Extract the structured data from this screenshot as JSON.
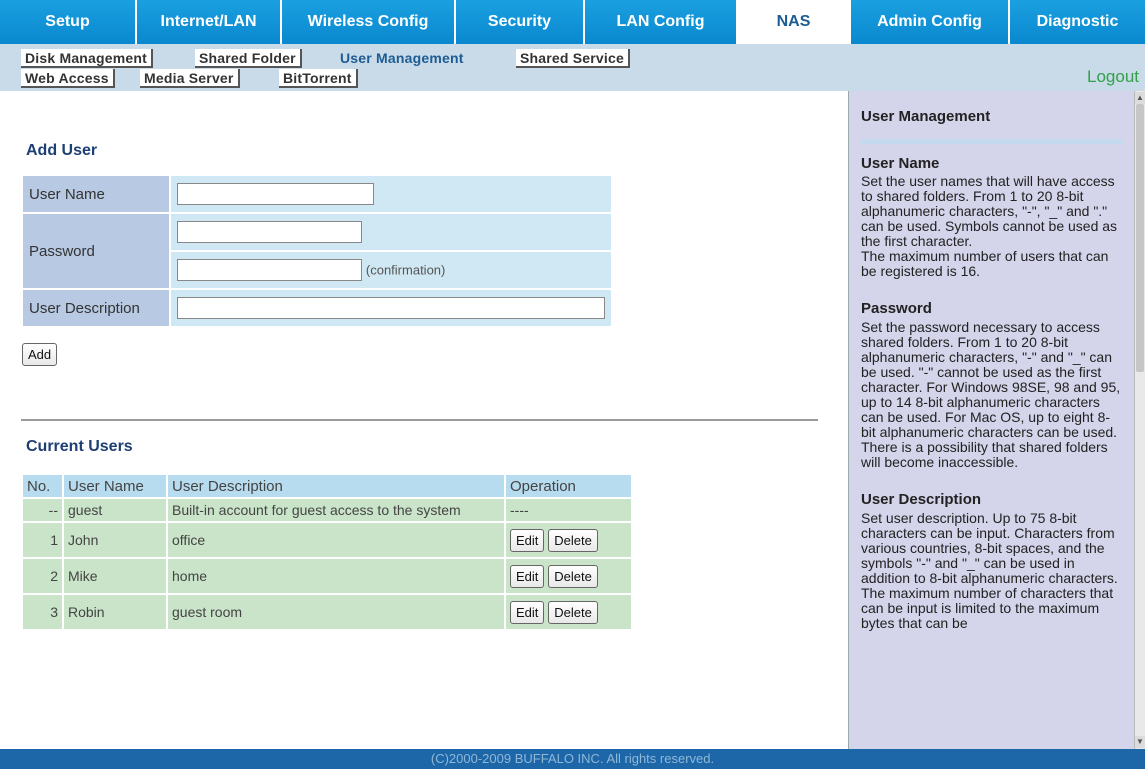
{
  "nav": {
    "tabs": [
      "Setup",
      "Internet/LAN",
      "Wireless Config",
      "Security",
      "LAN Config",
      "NAS",
      "Admin Config",
      "Diagnostic"
    ],
    "active_tab": "NAS"
  },
  "subnav": {
    "row1": [
      "Disk Management",
      "Shared Folder",
      "User Management",
      "Shared Service"
    ],
    "row2": [
      "Web Access",
      "Media Server",
      "BitTorrent"
    ],
    "active": "User Management",
    "logout": "Logout"
  },
  "add_user": {
    "heading": "Add User",
    "user_name_label": "User Name",
    "password_label": "Password",
    "confirmation_hint": "(confirmation)",
    "description_label": "User Description",
    "user_name_value": "",
    "password_value": "",
    "password_confirm_value": "",
    "description_value": "",
    "add_button": "Add"
  },
  "current_users": {
    "heading": "Current Users",
    "columns": [
      "No.",
      "User Name",
      "User Description",
      "Operation"
    ],
    "rows": [
      {
        "no": "--",
        "name": "guest",
        "desc": "Built-in account for guest access to the system",
        "op": "----"
      },
      {
        "no": "1",
        "name": "John",
        "desc": "office",
        "edit": "Edit",
        "delete": "Delete"
      },
      {
        "no": "2",
        "name": "Mike",
        "desc": "home",
        "edit": "Edit",
        "delete": "Delete"
      },
      {
        "no": "3",
        "name": "Robin",
        "desc": "guest room",
        "edit": "Edit",
        "delete": "Delete"
      }
    ]
  },
  "help": {
    "title": "User Management",
    "sections": [
      {
        "title": "User Name",
        "text": "Set the user names that will have access to shared folders. From 1 to 20 8-bit alphanumeric characters, \"-\", \"_\" and \".\" can be used. Symbols cannot be used as the first character.",
        "extra": "The maximum number of users that can be registered is 16."
      },
      {
        "title": "Password",
        "text": "Set the password necessary to access shared folders. From 1 to 20 8-bit alphanumeric characters, \"-\" and \"_\" can be used. \"-\" cannot be used as the first character. For Windows 98SE, 98 and 95, up to 14 8-bit alphanumeric characters can be used. For Mac OS, up to eight 8-bit alphanumeric characters can be used. There is a possibility that shared folders will become inaccessible."
      },
      {
        "title": "User Description",
        "text": "Set user description. Up to 75 8-bit characters can be input. Characters from various countries, 8-bit spaces, and the symbols \"-\" and \"_\" can be used in addition to 8-bit alphanumeric characters. The maximum number of characters that can be input is limited to the maximum bytes that can be"
      }
    ]
  },
  "footer": "(C)2000-2009 BUFFALO INC. All rights reserved.",
  "colors": {
    "tab_bg": "#0a88cf",
    "active_tab_text": "#1d5c93",
    "subnav_bg": "#c9dbe8",
    "label_bg": "#b7c9e3",
    "field_bg": "#d0e8f3",
    "row_bg": "#c9e4c9",
    "help_bg": "#d4d5eb",
    "footer_bg": "#1d67a8",
    "logout": "#33a04a"
  }
}
